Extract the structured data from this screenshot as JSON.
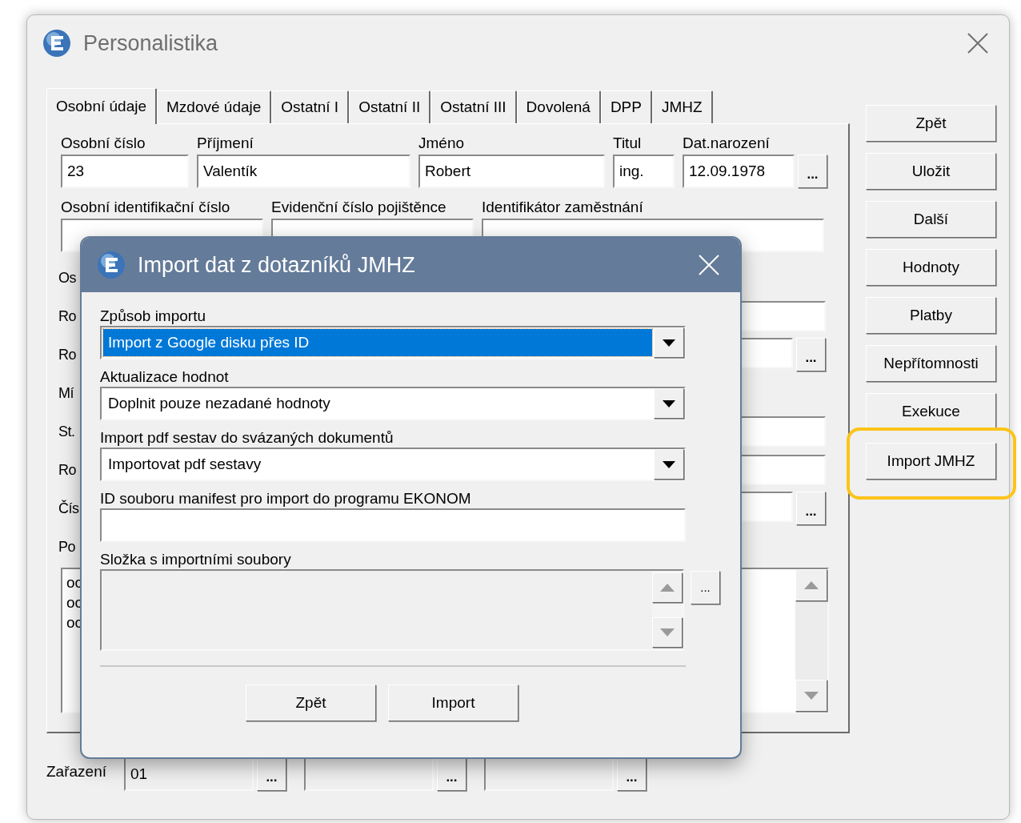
{
  "window": {
    "title": "Personalistika"
  },
  "tabs": [
    {
      "label": "Osobní údaje",
      "selected": true
    },
    {
      "label": "Mzdové údaje",
      "selected": false
    },
    {
      "label": "Ostatní I",
      "selected": false
    },
    {
      "label": "Ostatní II",
      "selected": false
    },
    {
      "label": "Ostatní III",
      "selected": false
    },
    {
      "label": "Dovolená",
      "selected": false
    },
    {
      "label": "DPP",
      "selected": false
    },
    {
      "label": "JMHZ",
      "selected": false
    }
  ],
  "fields_row1": [
    {
      "label": "Osobní číslo",
      "value": "23"
    },
    {
      "label": "Příjmení",
      "value": "Valentík"
    },
    {
      "label": "Jméno",
      "value": "Robert"
    },
    {
      "label": "Titul",
      "value": "ing."
    },
    {
      "label": "Dat.narození",
      "value": "12.09.1978",
      "button": "..."
    }
  ],
  "fields_row2": [
    {
      "label": "Osobní identifikační číslo"
    },
    {
      "label": "Evidenční číslo pojištěnce"
    },
    {
      "label": "Identifikátor zaměstnání"
    }
  ],
  "hidden_rows": [
    {
      "label": "Os",
      "field": false
    },
    {
      "label": "Ro",
      "field": true
    },
    {
      "label": "Ro",
      "field": true,
      "button": "..."
    },
    {
      "label": "Mí",
      "field": false
    },
    {
      "label": "St.",
      "field": true
    },
    {
      "label": "Ro",
      "field": true
    },
    {
      "label": "Čís",
      "field": true,
      "button": "..."
    },
    {
      "label": "Po",
      "field": false
    }
  ],
  "list": {
    "items": [
      "oc",
      "oc",
      "oc"
    ]
  },
  "side_buttons": [
    {
      "label": "Zpět",
      "highlighted": false
    },
    {
      "label": "Uložit",
      "highlighted": false
    },
    {
      "label": "Další",
      "highlighted": false
    },
    {
      "label": "Hodnoty",
      "highlighted": false
    },
    {
      "label": "Platby",
      "highlighted": false
    },
    {
      "label": "Nepřítomnosti",
      "highlighted": false
    },
    {
      "label": "Exekuce",
      "highlighted": false
    },
    {
      "label": "Import JMHZ",
      "highlighted": true
    }
  ],
  "classification": {
    "label": "Zařazení",
    "fields": [
      {
        "value": "01",
        "button": "..."
      },
      {
        "button": "..."
      },
      {
        "button": "..."
      }
    ]
  },
  "dialog": {
    "title": "Import dat z dotazníků JMHZ",
    "fields": [
      {
        "kind": "select",
        "label": "Způsob importu",
        "value": "Import z Google disku přes ID",
        "focused": true
      },
      {
        "kind": "select",
        "label": "Aktualizace hodnot",
        "value": "Doplnit pouze nezadané hodnoty",
        "focused": false
      },
      {
        "kind": "select",
        "label": "Import pdf sestav do svázaných dokumentů",
        "value": "Importovat pdf sestavy",
        "focused": false
      },
      {
        "kind": "text",
        "label": "ID souboru manifest pro import do programu EKONOM"
      },
      {
        "kind": "list",
        "label": "Složka s importními soubory",
        "button": "..."
      }
    ],
    "buttons": [
      "Zpět",
      "Import"
    ]
  }
}
